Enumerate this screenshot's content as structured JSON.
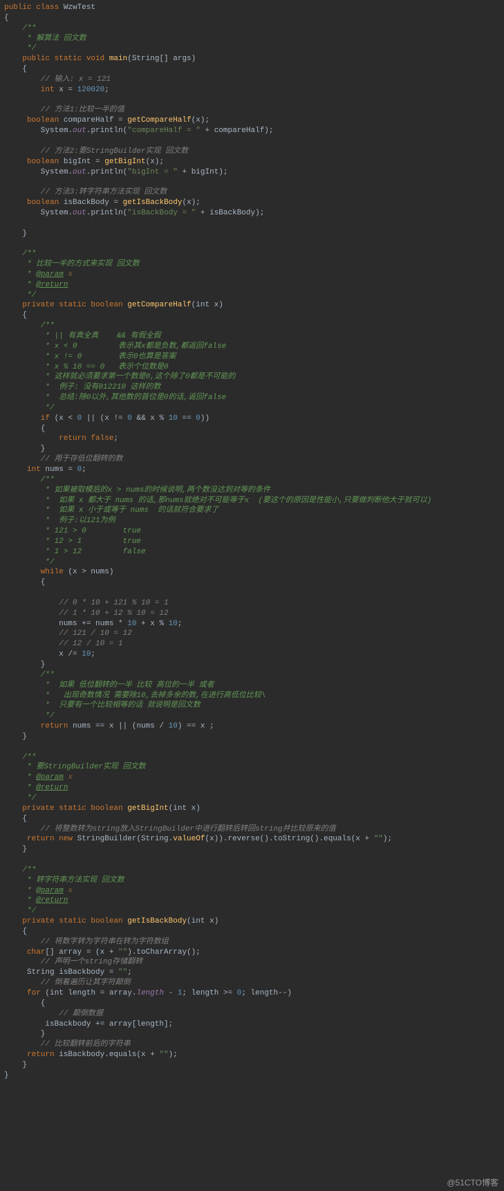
{
  "watermark": "@51CTO博客",
  "code": {
    "l1": "public class ",
    "className": "WzwTest",
    "l2": "{",
    "c1a": "    /**",
    "c1b": "     * 解算法 回文数",
    "c1c": "     */",
    "main_sig1": "    public static void ",
    "main_name": "main",
    "main_sig2": "(String[] args)",
    "l3": "    {",
    "c2": "        // 输入: x = 121",
    "int_x": "        int ",
    "x_var": "x = ",
    "x_val": "120020",
    "semi": ";",
    "c3": "        // 方法1:比较一半的值",
    "bool1a": "     boolean ",
    "bool1b": "compareHalf = ",
    "fn1": "getCompareHalf",
    "bool1c": "(x);",
    "p1a": "        System.",
    "out": "out",
    "p1b": ".println(",
    "str1": "\"compareHalf = \"",
    "p1c": " + compareHalf);",
    "c4": "        // 方法2:要StringBuilder实现 回文数",
    "bool2a": "     boolean ",
    "bool2b": "bigInt = ",
    "fn2": "getBigInt",
    "bool2c": "(x);",
    "str2": "\"bigInt = \"",
    "p2c": " + bigInt);",
    "c5": "        // 方法3:转字符串方法实现 回文数",
    "bool3a": "     boolean ",
    "bool3b": "isBackBody = ",
    "fn3": "getIsBackBody",
    "bool3c": "(x);",
    "str3": "\"isBackBody = \"",
    "p3c": " + isBackBody);",
    "l4": "    }",
    "d1a": "    /**",
    "d1b": "     * 比较一半的方式来实现 回文数",
    "d1c": "     * ",
    "param_tag": "@param",
    "d1c2": " x",
    "d1d": "     * ",
    "return_tag": "@return",
    "d1e": "     */",
    "m1a": "    private static boolean ",
    "m1name": "getCompareHalf",
    "m1b": "(int ",
    "m1p": "x",
    "m1c": ")",
    "l5": "    {",
    "dc1": "        /**",
    "dc2": "         * || 有真全真    && 有假全假",
    "dc3": "         * x < 0         表示其x都是负数,都返回false",
    "dc4": "         * x != 0        表示0也算是答案",
    "dc5": "         * x % 10 == 0   表示个位数是0",
    "dc6": "         * 这样就必须要求第一个数是0,这个除了0都是不可能的",
    "dc7": "         *  例子: 没有012210 这样的数",
    "dc8": "         *  总结:除0以外,其他数的首位是0的话,返回false",
    "dc9": "         */",
    "if1a": "        if ",
    "if1b": "(x < ",
    "zero": "0",
    "if1c": " || (x != ",
    "if1d": " && x % ",
    "ten": "10",
    "if1e": " == ",
    "if1f": "))",
    "l6": "        {",
    "ret_false": "            return false",
    "l7": "        }",
    "c6": "        // 用于存低位翻转的数",
    "nums_decl": "     int ",
    "nums_var": "nums = ",
    "dc10": "        /**",
    "dc11": "         * 如果被取模后的x > nums的时候说明,两个数没达到对等的条件",
    "dc12": "         *  如果 x 都大于 nums 的话,那nums就绝对不可能等于x  (要这个的原因是性能小,只要做判断他大于就可以)",
    "dc13": "         *  如果 x 小于或等于 nums  的话就符合要求了",
    "dc14": "         *  例子:以121为例",
    "dc15": "         * 121 > 0        true",
    "dc16": "         * 12 > 1         true",
    "dc17": "         * 1 > 12         false",
    "dc18": "         */",
    "while1": "        while ",
    "while2": "(x > nums)",
    "l8": "        {",
    "cc1": "            // 0 * 10 + 121 % 10 = 1",
    "cc2": "            // 1 * 10 + 12 % 10 = 12",
    "nums_upd1": "            nums += nums * ",
    "nums_upd2": " + x % ",
    "cc3": "            // 121 / 10 = 12",
    "cc4": "            // 12 / 10 = 1",
    "x_upd": "            x /= ",
    "l9": "        }",
    "dc20": "        /**",
    "dc21": "         *  如果 低位翻转的一半 比较 高位的一半 或者",
    "dc22": "         *   出现奇数情况 需要除10,去掉多余的数,在进行高低位比较\\",
    "dc23": "         *  只要有一个比较相等的话 就说明是回文数",
    "dc24": "         */",
    "ret1a": "        return ",
    "ret1b": "nums == x || (nums / ",
    "ret1c": ") == x ;",
    "l10": "    }",
    "d2a": "    /**",
    "d2b": "     * 要StringBuilder实现 回文数",
    "d2e": "     */",
    "m2a": "    private static boolean ",
    "m2name": "getBigInt",
    "m2b": "(int ",
    "m2p": "x",
    "m2c": ")",
    "l11": "    {",
    "c7": "        // 将整数转为string放入StringBuilder中进行翻转后转回string并比较原来的值",
    "ret2a": "     return new ",
    "ret2b": "StringBuilder(String.",
    "valueOf": "valueOf",
    "ret2c": "(x)).reverse().toString().equals(x + ",
    "empty_str": "\"\"",
    "ret2d": ");",
    "l12": "    }",
    "d3a": "    /**",
    "d3b": "     * 转字符串方法实现 回文数",
    "d3e": "     */",
    "m3a": "    private static boolean ",
    "m3name": "getIsBackBody",
    "m3b": "(int ",
    "m3p": "x",
    "m3c": ")",
    "l13": "    {",
    "c8": "        // 将数字转为字符串在转为字符数组",
    "arr1": "     char",
    "arr2": "[] array = (x + ",
    "arr3": ").toCharArray();",
    "c9": "        // 声明一个string存储翻转",
    "isb1": "     String isBackbody = ",
    "c10": "        // 倒着遍历让其字符颠倒",
    "for1": "     for ",
    "for2": "(int ",
    "for3": "length = array.",
    "length": "length",
    "for4": " - ",
    "one": "1",
    "for5": "; length >= ",
    "for6": "; length--)",
    "l14": "        {",
    "c11": "            // 颠倒数据",
    "isb2": "         isBackbody += array[length];",
    "l15": "        }",
    "c12": "        // 比较翻转前后的字符串",
    "ret3a": "     return ",
    "ret3b": "isBackbody.equals(x + ",
    "ret3c": ");",
    "l16": "    }",
    "l17": "}"
  }
}
